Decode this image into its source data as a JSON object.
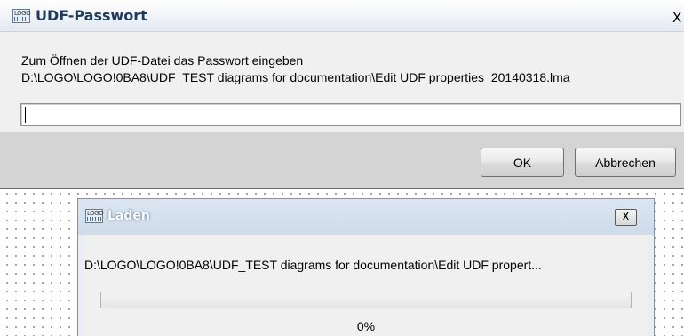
{
  "password_dialog": {
    "title": "UDF-Passwort",
    "close_glyph": "X",
    "prompt": "Zum Öffnen der UDF-Datei das Passwort eingeben",
    "file_path": "D:\\LOGO\\LOGO!0BA8\\UDF_TEST diagrams for documentation\\Edit UDF properties_20140318.lma",
    "password_value": "",
    "ok_label": "OK",
    "cancel_label": "Abbrechen"
  },
  "loading_dialog": {
    "title": "Laden",
    "close_glyph": "X",
    "file_path": "D:\\LOGO\\LOGO!0BA8\\UDF_TEST diagrams for documentation\\Edit UDF propert...",
    "progress_fraction": 0,
    "progress_text": "0%"
  },
  "icons": {
    "app_icon_text": "LOGO"
  },
  "colors": {
    "progress_fill": "#06b025",
    "title_text": "#1f3a5a"
  }
}
